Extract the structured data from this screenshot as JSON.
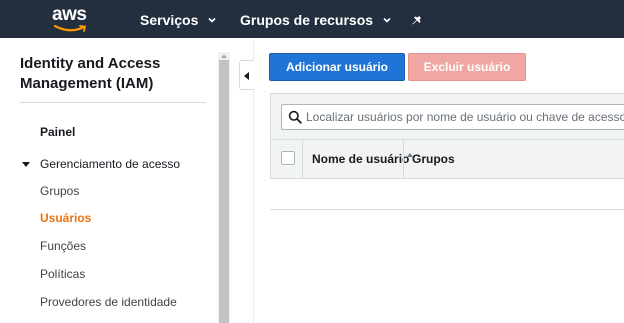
{
  "topbar": {
    "logo_text": "aws",
    "nav": [
      {
        "label": "Serviços"
      },
      {
        "label": "Grupos de recursos"
      }
    ]
  },
  "sidebar": {
    "title": "Identity and Access Management (IAM)",
    "panel_label": "Painel",
    "section_label": "Gerenciamento de acesso",
    "items": [
      {
        "label": "Grupos"
      },
      {
        "label": "Usuários",
        "active": true
      },
      {
        "label": "Funções"
      },
      {
        "label": "Políticas"
      },
      {
        "label": "Provedores de identidade"
      }
    ]
  },
  "toolbar": {
    "add_label": "Adicionar usuário",
    "delete_label": "Excluir usuário"
  },
  "search": {
    "placeholder": "Localizar usuários por nome de usuário ou chave de acesso"
  },
  "table": {
    "columns": [
      "Nome de usuário",
      "Grupos"
    ]
  },
  "colors": {
    "topbar_bg": "#232f3e",
    "primary_button": "#2074d5",
    "danger_button_disabled": "#f0a7a3",
    "active_nav": "#ec7211"
  }
}
